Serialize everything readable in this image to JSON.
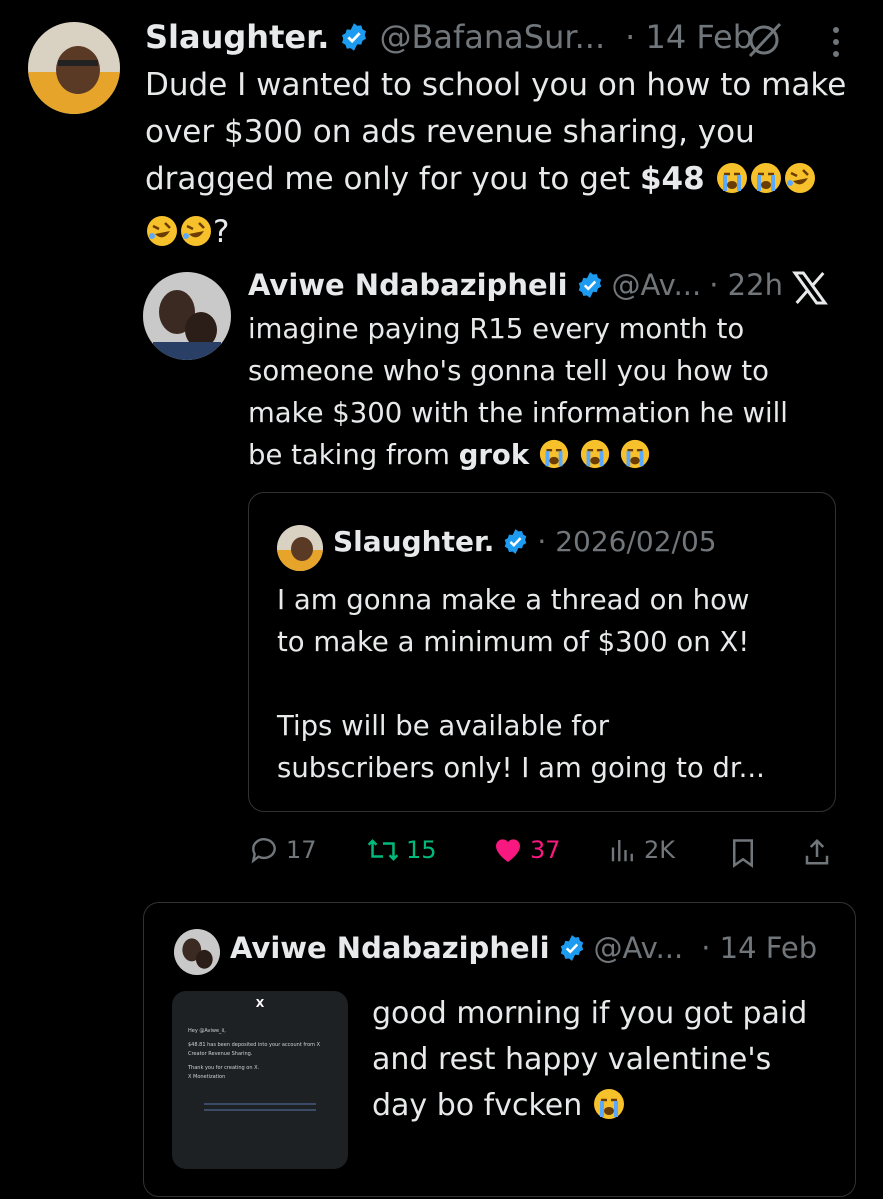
{
  "main_tweet": {
    "name": "Slaughter.",
    "handle": "@BafanaSur...",
    "time": "· 14 Feb",
    "text_line1": "Dude I wanted to school you on how to make",
    "text_line2": "over $300 on ads revenue sharing,  you",
    "text_line3_prefix": "dragged me only for you to get ",
    "text_line3_bold": "$48",
    "text_line4_suffix": "?"
  },
  "quoted_tweet": {
    "name": "Aviwe Ndabazipheli",
    "handle": "@Av...",
    "time": "· 22h",
    "text_line1": "imagine paying R15 every month to",
    "text_line2": "someone who's gonna tell you how to",
    "text_line3": "make $300 with the information he will",
    "text_line4_prefix": "be taking from ",
    "text_line4_bold": "grok"
  },
  "nested_quote": {
    "name": "Slaughter.",
    "time": "· 2026/02/05",
    "line1": "I am gonna make a thread on how",
    "line2": "to make a minimum of $300 on X!",
    "line3": "Tips will be available for",
    "line4": "subscribers only! I am going to dr..."
  },
  "actions": {
    "replies": "17",
    "reposts": "15",
    "likes": "37",
    "views": "2K"
  },
  "bottom_quote": {
    "name": "Aviwe Ndabazipheli",
    "handle": "@Av...",
    "time": "· 14 Feb",
    "text_line1": "good morning if you got paid",
    "text_line2": "and rest  happy valentine's",
    "text_line3": "day bo fvcken",
    "email": {
      "logo": "X",
      "greeting": "Hey @Aviwe_ii,",
      "body": "$48.81 has been deposited into your account from X Creator Revenue Sharing.",
      "thanks": "Thank you for creating on X.",
      "signoff": "X Monetization"
    }
  },
  "colors": {
    "verified": "#1d9bf0",
    "repost": "#00ba7c",
    "like": "#f91880",
    "muted": "#71767b"
  }
}
